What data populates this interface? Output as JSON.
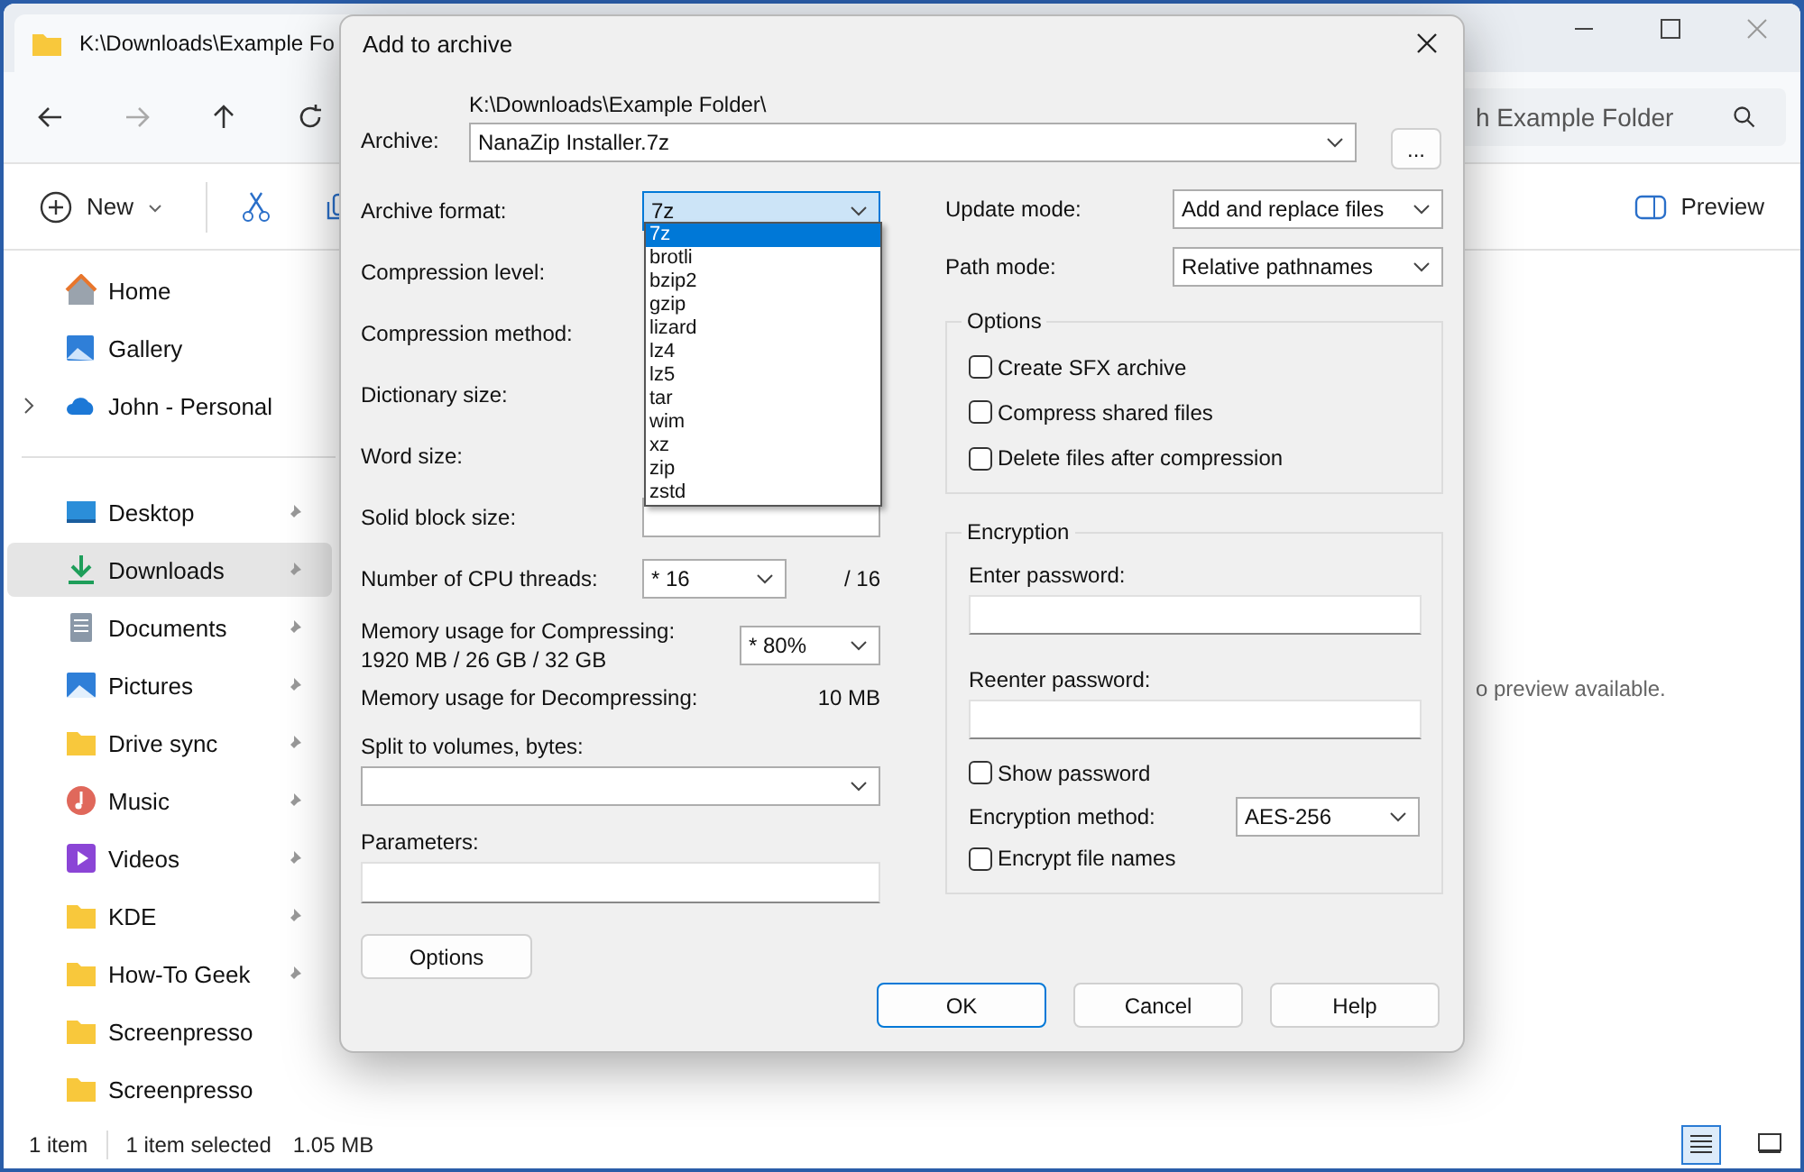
{
  "explorer": {
    "tab_title": "K:\\Downloads\\Example Fo",
    "search": {
      "placeholder": "h Example Folder"
    },
    "toolbar": {
      "new": "New",
      "preview": "Preview"
    },
    "sidebar": [
      {
        "label": "Home",
        "kind": "home",
        "selected": false,
        "pinned": false,
        "expandable": false
      },
      {
        "label": "Gallery",
        "kind": "gallery",
        "selected": false,
        "pinned": false,
        "expandable": false
      },
      {
        "label": "John - Personal",
        "kind": "cloud",
        "selected": false,
        "pinned": false,
        "expandable": true
      }
    ],
    "quick_access": [
      {
        "label": "Desktop",
        "kind": "desktop",
        "selected": false,
        "pinned": true,
        "expandable": false
      },
      {
        "label": "Downloads",
        "kind": "downloads",
        "selected": true,
        "pinned": true,
        "expandable": false
      },
      {
        "label": "Documents",
        "kind": "documents",
        "selected": false,
        "pinned": true,
        "expandable": false
      },
      {
        "label": "Pictures",
        "kind": "pictures",
        "selected": false,
        "pinned": true,
        "expandable": false
      },
      {
        "label": "Drive sync",
        "kind": "folder",
        "selected": false,
        "pinned": true,
        "expandable": false
      },
      {
        "label": "Music",
        "kind": "music",
        "selected": false,
        "pinned": true,
        "expandable": false
      },
      {
        "label": "Videos",
        "kind": "videos",
        "selected": false,
        "pinned": true,
        "expandable": false
      },
      {
        "label": "KDE",
        "kind": "folder",
        "selected": false,
        "pinned": true,
        "expandable": false
      },
      {
        "label": "How-To Geek",
        "kind": "folder",
        "selected": false,
        "pinned": true,
        "expandable": false
      },
      {
        "label": "Screenpresso",
        "kind": "folder",
        "selected": false,
        "pinned": false,
        "expandable": false
      },
      {
        "label": "Screenpresso",
        "kind": "folder",
        "selected": false,
        "pinned": false,
        "expandable": false
      }
    ],
    "preview_message": "o preview available.",
    "status_bar": {
      "count": "1 item",
      "selection": "1 item selected",
      "size": "1.05 MB"
    },
    "views": [
      {
        "kind": "details",
        "selected": true
      },
      {
        "kind": "tiles",
        "selected": false
      }
    ]
  },
  "dialog": {
    "title": "Add to archive",
    "archive": {
      "label": "Archive:",
      "folder": "K:\\Downloads\\Example Folder\\",
      "filename": "NanaZip Installer.7z",
      "browse": "..."
    },
    "format": {
      "label": "Archive format:",
      "value": "7z",
      "options": [
        {
          "label": "7z",
          "selected": true
        },
        {
          "label": "brotli",
          "selected": false
        },
        {
          "label": "bzip2",
          "selected": false
        },
        {
          "label": "gzip",
          "selected": false
        },
        {
          "label": "lizard",
          "selected": false
        },
        {
          "label": "lz4",
          "selected": false
        },
        {
          "label": "lz5",
          "selected": false
        },
        {
          "label": "tar",
          "selected": false
        },
        {
          "label": "wim",
          "selected": false
        },
        {
          "label": "xz",
          "selected": false
        },
        {
          "label": "zip",
          "selected": false
        },
        {
          "label": "zstd",
          "selected": false
        }
      ]
    },
    "hidden_rows": [
      "Compression level:",
      "Compression method:",
      "Dictionary size:",
      "Word size:",
      "Solid block size:"
    ],
    "cpu_threads": {
      "label": "Number of CPU threads:",
      "value": "* 16",
      "max": "/ 16"
    },
    "memory_compress": {
      "label": "Memory usage for Compressing:",
      "detail": "1920 MB / 26 GB / 32 GB",
      "value": "* 80%"
    },
    "memory_decompress": {
      "label": "Memory usage for Decompressing:",
      "value": "10 MB"
    },
    "split": {
      "label": "Split to volumes, bytes:"
    },
    "parameters": {
      "label": "Parameters:"
    },
    "options_button": "Options",
    "update_mode": {
      "label": "Update mode:",
      "value": "Add and replace files"
    },
    "path_mode": {
      "label": "Path mode:",
      "value": "Relative pathnames"
    },
    "options_group": {
      "title": "Options",
      "checkboxes": [
        {
          "label": "Create SFX archive",
          "checked": false
        },
        {
          "label": "Compress shared files",
          "checked": false
        },
        {
          "label": "Delete files after compression",
          "checked": false
        }
      ]
    },
    "encryption": {
      "title": "Encryption",
      "enter_password": {
        "label": "Enter password:"
      },
      "reenter_password": {
        "label": "Reenter password:"
      },
      "show_password": {
        "label": "Show password",
        "checked": false
      },
      "method": {
        "label": "Encryption method:",
        "value": "AES-256"
      },
      "encrypt_names": {
        "label": "Encrypt file names",
        "checked": false
      }
    },
    "buttons": [
      {
        "label": "OK",
        "default": true
      },
      {
        "label": "Cancel",
        "default": false
      },
      {
        "label": "Help",
        "default": false
      }
    ]
  }
}
